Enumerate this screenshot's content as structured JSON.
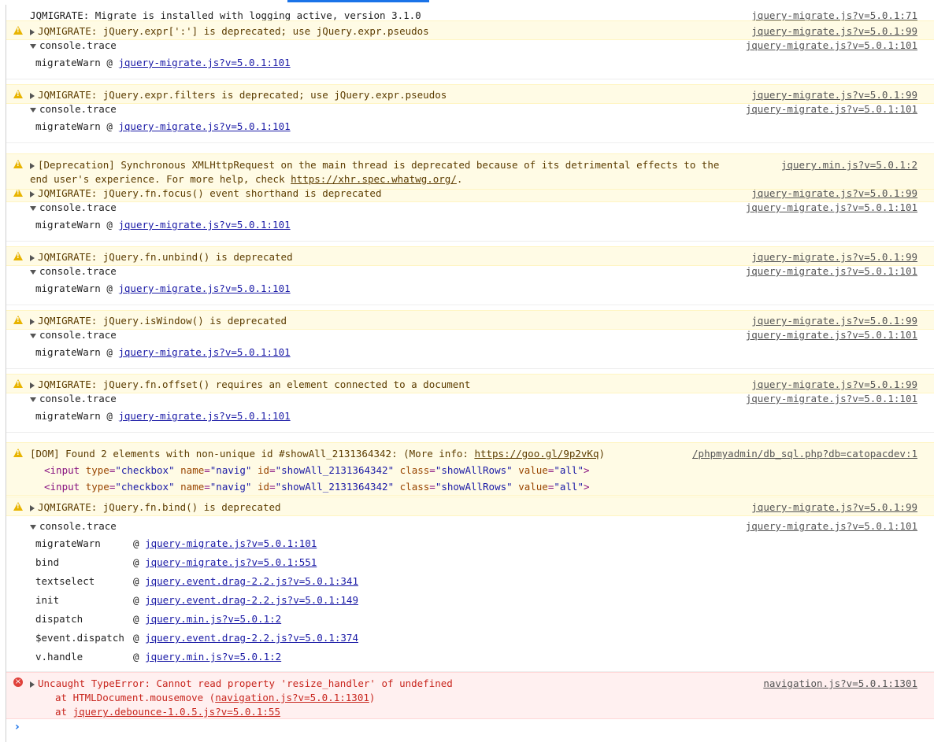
{
  "console": {
    "info_line": {
      "text": "JQMIGRATE: Migrate is installed with logging active, version 3.1.0",
      "source": "jquery-migrate.js?v=5.0.1:71"
    },
    "warnings": [
      {
        "text": "JQMIGRATE: jQuery.expr[':'] is deprecated; use jQuery.expr.pseudos",
        "source": "jquery-migrate.js?v=5.0.1:99",
        "trace_label": "console.trace",
        "trace_source": "jquery-migrate.js?v=5.0.1:101",
        "frame_fn": "migrateWarn",
        "frame_at": "@",
        "frame_link": "jquery-migrate.js?v=5.0.1:101"
      },
      {
        "text": "JQMIGRATE: jQuery.expr.filters is deprecated; use jQuery.expr.pseudos",
        "source": "jquery-migrate.js?v=5.0.1:99",
        "trace_label": "console.trace",
        "trace_source": "jquery-migrate.js?v=5.0.1:101",
        "frame_fn": "migrateWarn",
        "frame_at": "@",
        "frame_link": "jquery-migrate.js?v=5.0.1:101"
      },
      {
        "text": "JQMIGRATE: jQuery.fn.focus() event shorthand is deprecated",
        "source": "jquery-migrate.js?v=5.0.1:99",
        "trace_label": "console.trace",
        "trace_source": "jquery-migrate.js?v=5.0.1:101",
        "frame_fn": "migrateWarn",
        "frame_at": "@",
        "frame_link": "jquery-migrate.js?v=5.0.1:101"
      },
      {
        "text": "JQMIGRATE: jQuery.fn.unbind() is deprecated",
        "source": "jquery-migrate.js?v=5.0.1:99",
        "trace_label": "console.trace",
        "trace_source": "jquery-migrate.js?v=5.0.1:101",
        "frame_fn": "migrateWarn",
        "frame_at": "@",
        "frame_link": "jquery-migrate.js?v=5.0.1:101"
      },
      {
        "text": "JQMIGRATE: jQuery.isWindow() is deprecated",
        "source": "jquery-migrate.js?v=5.0.1:99",
        "trace_label": "console.trace",
        "trace_source": "jquery-migrate.js?v=5.0.1:101",
        "frame_fn": "migrateWarn",
        "frame_at": "@",
        "frame_link": "jquery-migrate.js?v=5.0.1:101"
      },
      {
        "text": "JQMIGRATE: jQuery.fn.offset() requires an element connected to a document",
        "source": "jquery-migrate.js?v=5.0.1:99",
        "trace_label": "console.trace",
        "trace_source": "jquery-migrate.js?v=5.0.1:101",
        "frame_fn": "migrateWarn",
        "frame_at": "@",
        "frame_link": "jquery-migrate.js?v=5.0.1:101"
      }
    ],
    "deprecation": {
      "line1": "[Deprecation] Synchronous XMLHttpRequest on the main thread is deprecated because of its detrimental effects to the",
      "line2_prefix": "end user's experience. For more help, check ",
      "line2_link": "https://xhr.spec.whatwg.org/",
      "line2_suffix": ".",
      "source": "jquery.min.js?v=5.0.1:2"
    },
    "dom_warning": {
      "prefix": "[DOM] Found 2 elements with non-unique id #showAll_2131364342: (More info: ",
      "link": "https://goo.gl/9p2vKq",
      "suffix": ")",
      "source": "/phpmyadmin/db_sql.php?db=catopacdev:1",
      "elements": [
        {
          "tag": "input",
          "attrs": [
            [
              "type",
              "checkbox"
            ],
            [
              "name",
              "navig"
            ],
            [
              "id",
              "showAll_2131364342"
            ],
            [
              "class",
              "showAllRows"
            ],
            [
              "value",
              "all"
            ]
          ]
        },
        {
          "tag": "input",
          "attrs": [
            [
              "type",
              "checkbox"
            ],
            [
              "name",
              "navig"
            ],
            [
              "id",
              "showAll_2131364342"
            ],
            [
              "class",
              "showAllRows"
            ],
            [
              "value",
              "all"
            ]
          ]
        }
      ]
    },
    "bind_warning": {
      "text": "JQMIGRATE: jQuery.fn.bind() is deprecated",
      "source": "jquery-migrate.js?v=5.0.1:99",
      "trace_label": "console.trace",
      "trace_source": "jquery-migrate.js?v=5.0.1:101",
      "frames": [
        {
          "fn": "migrateWarn",
          "at": "@",
          "link": "jquery-migrate.js?v=5.0.1:101"
        },
        {
          "fn": "bind",
          "at": "@",
          "link": "jquery-migrate.js?v=5.0.1:551"
        },
        {
          "fn": "textselect",
          "at": "@",
          "link": "jquery.event.drag-2.2.js?v=5.0.1:341"
        },
        {
          "fn": "init",
          "at": "@",
          "link": "jquery.event.drag-2.2.js?v=5.0.1:149"
        },
        {
          "fn": "dispatch",
          "at": "@",
          "link": "jquery.min.js?v=5.0.1:2"
        },
        {
          "fn": "$event.dispatch",
          "at": "@",
          "link": "jquery.event.drag-2.2.js?v=5.0.1:374"
        },
        {
          "fn": "v.handle",
          "at": "@",
          "link": "jquery.min.js?v=5.0.1:2"
        }
      ]
    },
    "error": {
      "text": "Uncaught TypeError: Cannot read property 'resize_handler' of undefined",
      "source": "navigation.js?v=5.0.1:1301",
      "stack1_prefix": "at HTMLDocument.mousemove (",
      "stack1_link": "navigation.js?v=5.0.1:1301",
      "stack1_suffix": ")",
      "stack2_prefix": "at ",
      "stack2_link": "jquery.debounce-1.0.5.js?v=5.0.1:55"
    },
    "prompt_symbol": "›"
  },
  "colors": {
    "warn_bg": "#fffbe5",
    "error_bg": "#fff0f0",
    "error_text": "#c8261e",
    "accent": "#1a73e8"
  }
}
